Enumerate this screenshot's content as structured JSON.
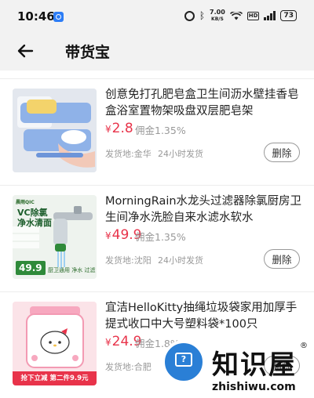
{
  "status_bar": {
    "time": "10:46",
    "net_speed_value": "7.00",
    "net_speed_unit": "KB/S",
    "network_badge": "HD",
    "network_gen": "5G",
    "battery": "73"
  },
  "header": {
    "title": "带货宝"
  },
  "products": [
    {
      "title": "创意免打孔肥皂盒卫生间沥水壁挂香皂盒浴室置物架吸盘双层肥皂架",
      "currency": "¥",
      "price": "2.8",
      "commission": "佣金1.35%",
      "shipping": "发货地:金华",
      "delivery": "24小时发货",
      "delete_label": "删除",
      "thumb_icon": "soap-dish-image"
    },
    {
      "title": "MorningRain水龙头过滤器除氯厨房卫生间净水洗脸自来水滤水软水",
      "currency": "¥",
      "price": "49.9",
      "commission": "佣金1.35%",
      "shipping": "发货地:沈阳",
      "delivery": "24小时发货",
      "delete_label": "删除",
      "thumb_icon": "faucet-filter-image",
      "thumb_text": {
        "brand": "晨雨QIC",
        "headline_1": "VC除氯",
        "headline_2": "净水清面",
        "price": "49.9",
        "note": "厨卫通用 净水 过滤"
      }
    },
    {
      "title": "宜洁HelloKitty抽绳垃圾袋家用加厚手提式收口中大号塑料袋*100只",
      "currency": "¥",
      "price": "24.9",
      "commission": "佣金1.8%",
      "shipping": "发货地:合肥",
      "delivery": "",
      "delete_label": "删除",
      "thumb_icon": "hello-kitty-bag-image",
      "thumb_text": {
        "promo": "抢下立减 第二件9.9元"
      }
    }
  ],
  "watermark": {
    "text": "知识屋",
    "registered": "®",
    "url": "zhishiwu.com",
    "icon": "question-screen-icon"
  },
  "colors": {
    "price": "#e8334a",
    "header_bg": "#f2f2f2",
    "muted_text": "#999999"
  }
}
